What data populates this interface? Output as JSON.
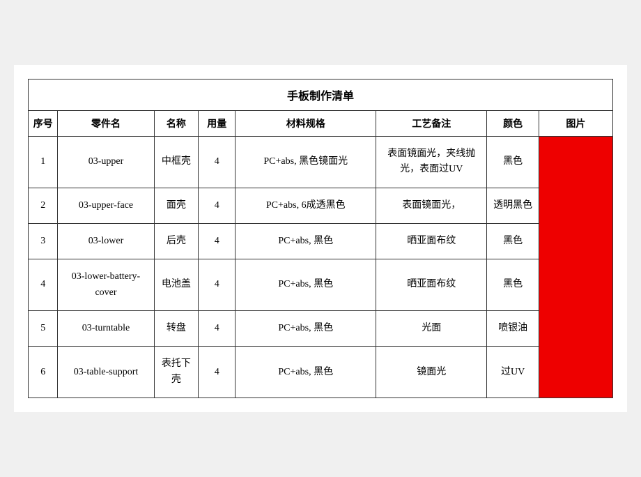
{
  "title": "手板制作清单",
  "headers": {
    "seq": "序号",
    "part_code": "零件名",
    "name": "名称",
    "qty": "用量",
    "spec": "材料规格",
    "craft": "工艺备注",
    "color": "颜色",
    "image": "图片"
  },
  "rows": [
    {
      "seq": "1",
      "part_code": "03-upper",
      "name": "中框壳",
      "qty": "4",
      "spec": "PC+abs, 黑色镜面光",
      "craft": "表面镜面光，夹线抛光，表面过UV",
      "color": "黑色"
    },
    {
      "seq": "2",
      "part_code": "03-upper-face",
      "name": "面壳",
      "qty": "4",
      "spec": "PC+abs, 6成透黑色",
      "craft": "表面镜面光，",
      "color": "透明黑色"
    },
    {
      "seq": "3",
      "part_code": "03-lower",
      "name": "后壳",
      "qty": "4",
      "spec": "PC+abs, 黑色",
      "craft": "晒亚面布纹",
      "color": "黑色"
    },
    {
      "seq": "4",
      "part_code": "03-lower-battery-cover",
      "name": "电池盖",
      "qty": "4",
      "spec": "PC+abs, 黑色",
      "craft": "晒亚面布纹",
      "color": "黑色"
    },
    {
      "seq": "5",
      "part_code": "03-turntable",
      "name": "转盘",
      "qty": "4",
      "spec": "PC+abs, 黑色",
      "craft": "光面",
      "color": "喷银油"
    },
    {
      "seq": "6",
      "part_code": "03-table-support",
      "name": "表托下壳",
      "qty": "4",
      "spec": "PC+abs, 黑色",
      "craft": "镜面光",
      "color": "过UV"
    }
  ]
}
